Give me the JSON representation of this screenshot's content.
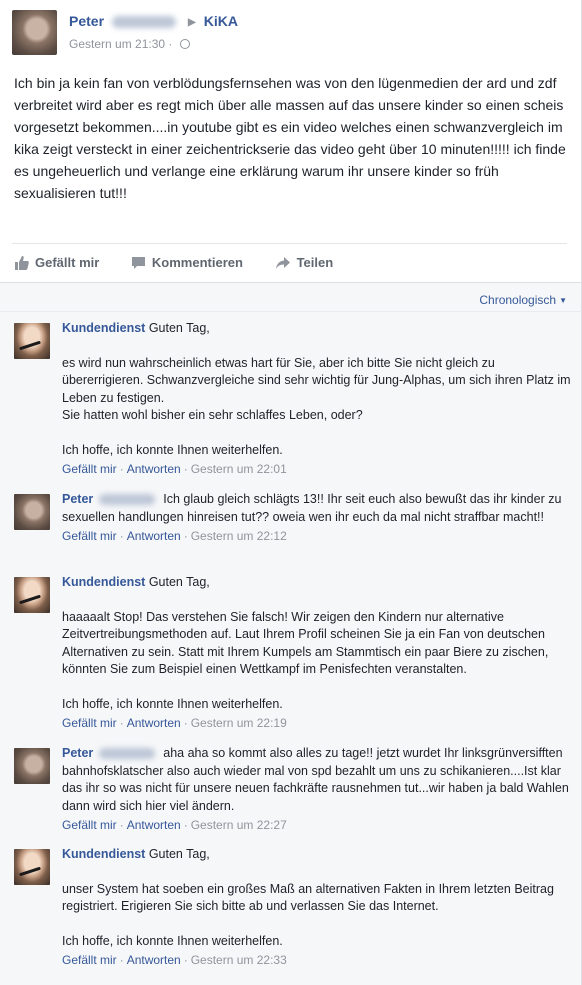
{
  "post": {
    "author": "Peter",
    "target": "KiKA",
    "timestamp": "Gestern um 21:30",
    "text": "Ich bin ja kein fan von verblödungsfernsehen was von den lügenmedien der ard und zdf verbreitet wird aber es regt mich über alle massen auf das unsere kinder so einen scheis vorgesetzt bekommen....in youtube gibt es ein video welches einen schwanzvergleich im kika zeigt versteckt in einer zeichentrickserie das video geht über 10 minuten!!!!! ich finde es ungeheuerlich und verlange eine erklärung warum ihr unsere kinder so früh sexualisieren tut!!!",
    "actions": {
      "like": "Gefällt mir",
      "comment": "Kommentieren",
      "share": "Teilen"
    }
  },
  "sort_label": "Chronologisch",
  "comment_actions": {
    "like": "Gefällt mir",
    "reply": "Antworten"
  },
  "comments": [
    {
      "author": "Kundendienst",
      "first": "Guten Tag,",
      "body": "es wird nun wahrscheinlich etwas hart für Sie, aber ich bitte Sie nicht gleich zu übererrigieren. Schwanzvergleiche sind sehr wichtig für Jung-Alphas, um sich ihren Platz im Leben zu festigen.",
      "body2": "Sie hatten wohl bisher ein sehr schlaffes Leben, oder?",
      "closing": "Ich hoffe, ich konnte Ihnen weiterhelfen.",
      "time": "Gestern um 22:01"
    },
    {
      "author": "Peter",
      "text": "Ich glaub gleich schlägts 13!! Ihr seit euch also bewußt das ihr kinder zu sexuellen handlungen hinreisen tut?? oweia wen ihr euch da mal nicht straffbar macht!!",
      "time": "Gestern um 22:12"
    },
    {
      "author": "Kundendienst",
      "first": "Guten Tag,",
      "body": "haaaaalt Stop! Das verstehen Sie falsch! Wir zeigen den Kindern nur alternative Zeitvertreibungsmethoden auf. Laut Ihrem Profil scheinen Sie ja ein Fan von deutschen Alternativen zu sein. Statt mit Ihrem Kumpels am Stammtisch ein paar Biere zu zischen, könnten Sie zum Beispiel einen Wettkampf im Penisfechten veranstalten.",
      "closing": "Ich hoffe, ich konnte Ihnen weiterhelfen.",
      "time": "Gestern um 22:19"
    },
    {
      "author": "Peter",
      "text": "aha aha so kommt also alles zu tage!! jetzt wurdet Ihr linksgrünversifften bahnhofsklatscher also auch wieder mal von spd bezahlt um uns zu schikanieren....Ist klar das ihr so was nicht für unsere neuen fachkräfte rausnehmen tut...wir haben ja bald Wahlen dann wird sich hier viel ändern.",
      "time": "Gestern um 22:27"
    },
    {
      "author": "Kundendienst",
      "first": "Guten Tag,",
      "body": "unser System hat soeben ein großes Maß an alternativen Fakten in Ihrem letzten Beitrag registriert. Erigieren Sie sich bitte ab und verlassen Sie das Internet.",
      "closing": "Ich hoffe, ich konnte Ihnen weiterhelfen.",
      "time": "Gestern um 22:33"
    }
  ]
}
